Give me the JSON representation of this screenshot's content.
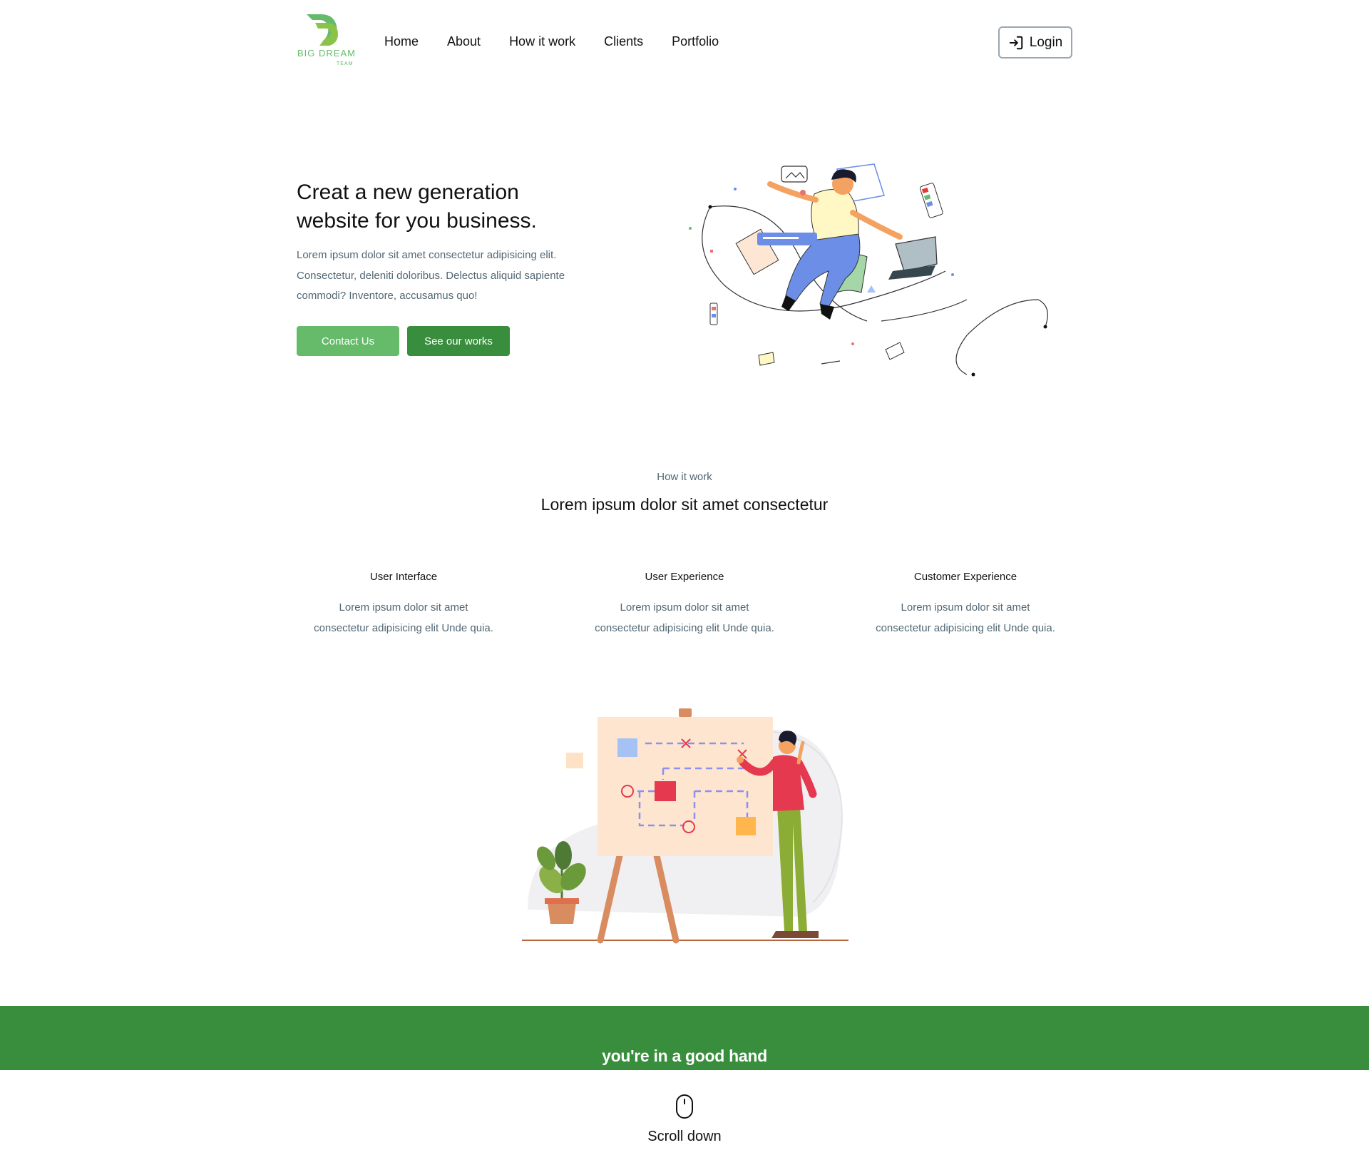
{
  "brand": {
    "logo_text": "BIG DREAM",
    "logo_subtext": "TEAM",
    "primary_color": "#66bb6a",
    "dark_green": "#388e3c"
  },
  "nav": {
    "items": [
      {
        "label": "Home"
      },
      {
        "label": "About"
      },
      {
        "label": "How it work"
      },
      {
        "label": "Clients"
      },
      {
        "label": "Portfolio"
      }
    ],
    "login_label": "Login",
    "login_icon": "sign-in-icon"
  },
  "hero": {
    "title": "Creat a new generation website for you business.",
    "description": "Lorem ipsum dolor sit amet consectetur adipisicing elit. Consectetur, deleniti doloribus. Delectus aliquid sapiente commodi? Inventore, accusamus quo!",
    "contact_label": "Contact Us",
    "works_label": "See our works"
  },
  "how": {
    "eyebrow": "How it work",
    "title": "Lorem ipsum dolor sit amet consectetur",
    "features": [
      {
        "title": "User Interface",
        "line1": "Lorem ipsum dolor sit amet",
        "line2": "consectetur adipisicing elit Unde quia."
      },
      {
        "title": "User Experience",
        "line1": "Lorem ipsum dolor sit amet",
        "line2": "consectetur adipisicing elit Unde quia."
      },
      {
        "title": "Customer Experience",
        "line1": "Lorem ipsum dolor sit amet",
        "line2": "consectetur adipisicing elit Unde quia."
      }
    ]
  },
  "banner": {
    "text": "you're in a good hand"
  },
  "scroll": {
    "label": "Scroll down",
    "icon": "mouse-icon"
  }
}
